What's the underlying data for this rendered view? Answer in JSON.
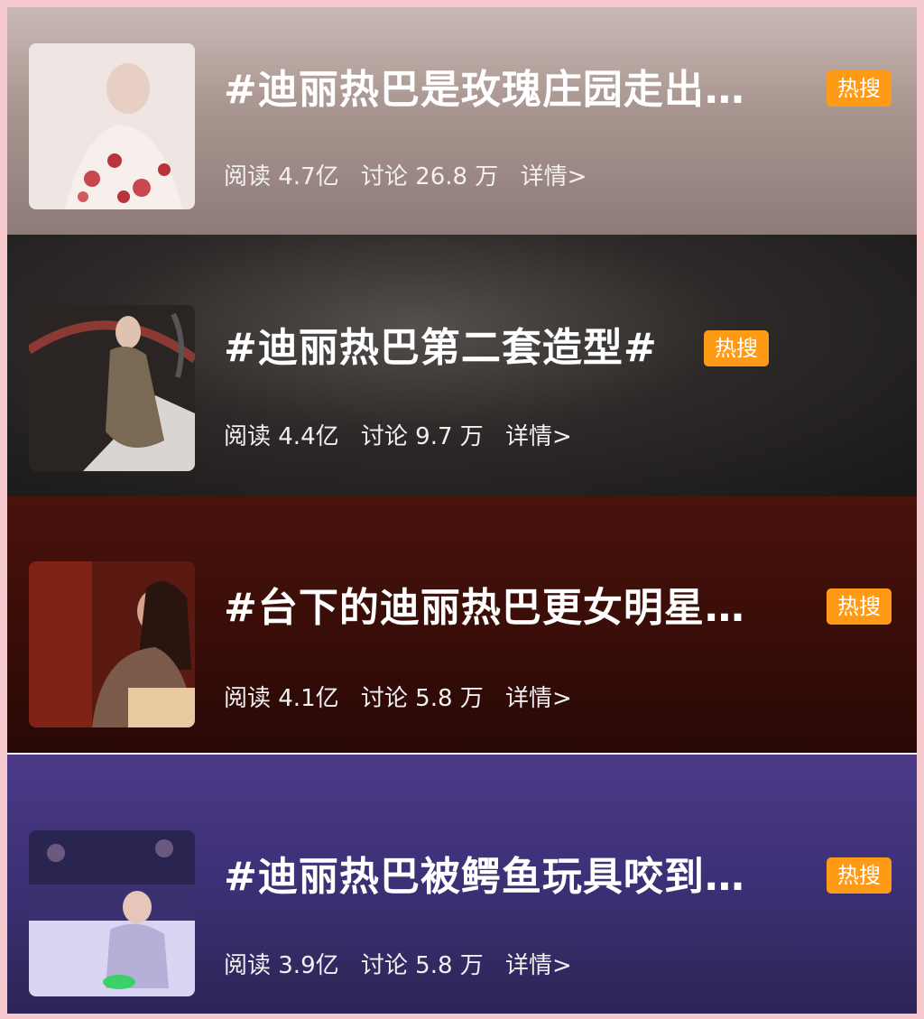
{
  "topics": [
    {
      "title": "#迪丽热巴是玫瑰庄园走出…",
      "badge": "热搜",
      "reads": "阅读 4.7亿",
      "discussions": "讨论 26.8 万",
      "details": "详情>"
    },
    {
      "title": "#迪丽热巴第二套造型#",
      "badge": "热搜",
      "reads": "阅读 4.4亿",
      "discussions": "讨论 9.7 万",
      "details": "详情>"
    },
    {
      "title": "#台下的迪丽热巴更女明星…",
      "badge": "热搜",
      "reads": "阅读 4.1亿",
      "discussions": "讨论 5.8 万",
      "details": "详情>"
    },
    {
      "title": "#迪丽热巴被鳄鱼玩具咬到…",
      "badge": "热搜",
      "reads": "阅读 3.9亿",
      "discussions": "讨论 5.8 万",
      "details": "详情>"
    }
  ],
  "colors": {
    "badge": "#ff9a16",
    "frame": "#f6c9cf",
    "text": "#ffffff"
  }
}
